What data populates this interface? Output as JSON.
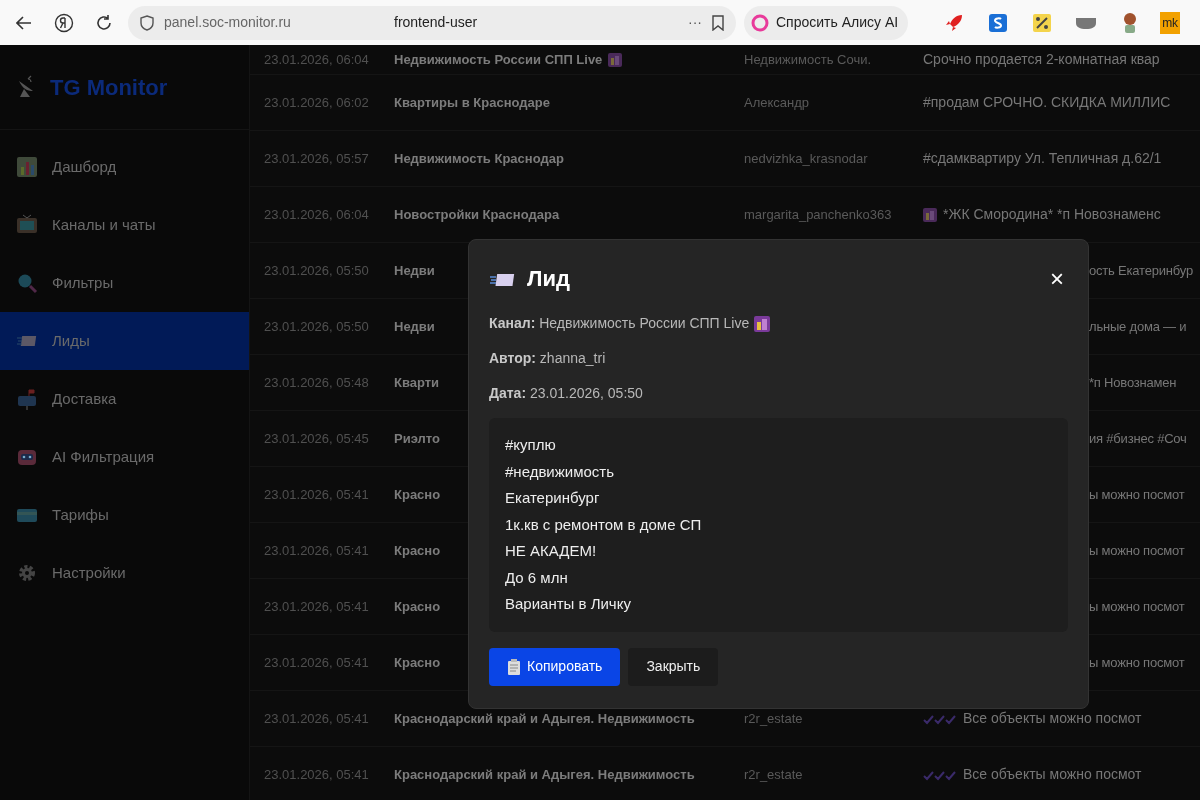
{
  "browser": {
    "url": "panel.soc-monitor.ru",
    "page_title": "frontend-user",
    "more": "···",
    "alice_button": "Спросить Алису AI",
    "extension_text": "mk"
  },
  "sidebar": {
    "logo": "TG Monitor",
    "items": [
      {
        "label": "Дашборд",
        "selected": false
      },
      {
        "label": "Каналы и чаты",
        "selected": false
      },
      {
        "label": "Фильтры",
        "selected": false
      },
      {
        "label": "Лиды",
        "selected": true
      },
      {
        "label": "Доставка",
        "selected": false
      },
      {
        "label": "AI Фильтрация",
        "selected": false
      },
      {
        "label": "Тарифы",
        "selected": false
      },
      {
        "label": "Настройки",
        "selected": false
      }
    ]
  },
  "table": {
    "rows": [
      {
        "date": "23.01.2026, 06:04",
        "channel": "Недвижимость России СПП Live",
        "channel_emoji": true,
        "author": "Недвижимость Сочи.",
        "message": "Срочно продается 2-комнатная квар",
        "covered": false
      },
      {
        "date": "23.01.2026, 06:02",
        "channel": "Квартиры в Краснодаре",
        "author": "Александр",
        "message": "#продам СРОЧНО. СКИДКА МИЛЛИС",
        "covered": false
      },
      {
        "date": "23.01.2026, 05:57",
        "channel": "Недвижимость Краснодар",
        "author": "nedvizhka_krasnodar",
        "message": "#сдамквартиру Ул. Тепличная д.62/1",
        "covered": false
      },
      {
        "date": "23.01.2026, 06:04",
        "channel": "Новостройки Краснодара",
        "author": "margarita_panchenko363",
        "message": "*ЖК Смородина* *п Новознаменс",
        "message_emoji": true,
        "covered": false
      },
      {
        "date": "23.01.2026, 05:50",
        "channel": "Недви",
        "message": "ость Екатеринбур",
        "covered": true
      },
      {
        "date": "23.01.2026, 05:50",
        "channel": "Недви",
        "message": "льные дома — и",
        "covered": true
      },
      {
        "date": "23.01.2026, 05:48",
        "channel": "Кварти",
        "message": "*п Новознамен",
        "covered": true
      },
      {
        "date": "23.01.2026, 05:45",
        "channel": "Риэлто",
        "message": "ия #бизнес #Соч",
        "covered": true
      },
      {
        "date": "23.01.2026, 05:41",
        "channel": "Красно",
        "message": "ы можно посмот",
        "covered": true
      },
      {
        "date": "23.01.2026, 05:41",
        "channel": "Красно",
        "message": "ы можно посмот",
        "covered": true
      },
      {
        "date": "23.01.2026, 05:41",
        "channel": "Красно",
        "message": "ы можно посмот",
        "covered": true
      },
      {
        "date": "23.01.2026, 05:41",
        "channel": "Красно",
        "message": "ы можно посмот",
        "covered": true
      },
      {
        "date": "23.01.2026, 05:41",
        "channel": "Краснодарский край и Адыгея. Недвижимость",
        "author": "r2r_estate",
        "message": "Все объекты можно посмот",
        "message_checks": true,
        "covered": false
      },
      {
        "date": "23.01.2026, 05:41",
        "channel": "Краснодарский край и Адыгея. Недвижимость",
        "author": "r2r_estate",
        "message": "Все объекты можно посмот",
        "message_checks": true,
        "covered": false
      }
    ]
  },
  "modal": {
    "title": "Лид",
    "close": "×",
    "fields": [
      {
        "label": "Канал:",
        "value": "Недвижимость России СПП Live",
        "emoji": true
      },
      {
        "label": "Автор:",
        "value": "zhanna_tri"
      },
      {
        "label": "Дата:",
        "value": "23.01.2026, 05:50"
      }
    ],
    "message_lines": [
      "#куплю",
      "#недвижимость",
      "Екатеринбург",
      "1к.кв с ремонтом в доме СП",
      "НЕ АКАДЕМ!",
      "До 6 млн",
      "Варианты в Личку"
    ],
    "buttons": [
      {
        "label": "Копировать",
        "kind": "primary"
      },
      {
        "label": "Закрыть",
        "kind": "secondary"
      }
    ]
  }
}
